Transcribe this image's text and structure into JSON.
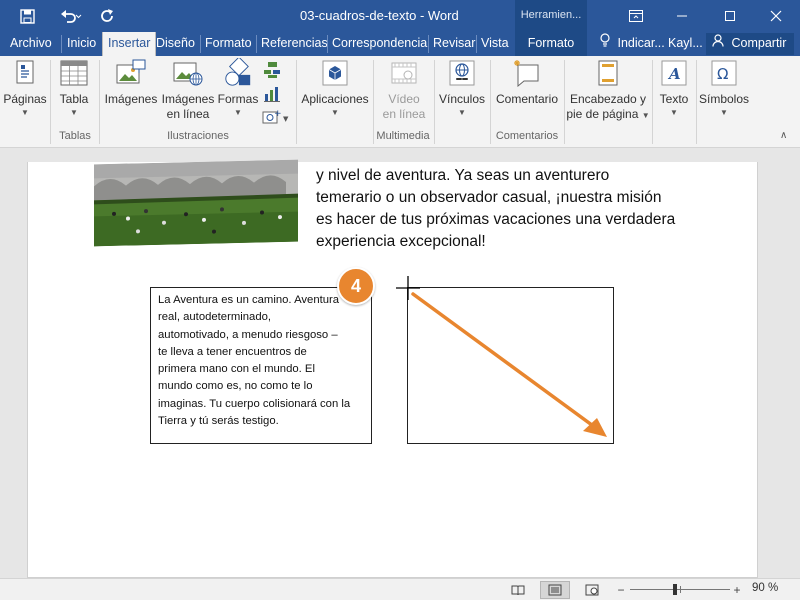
{
  "window": {
    "title": "03-cuadros-de-texto  -  Word",
    "contextual_group": "Herramien...",
    "colors": {
      "titlebar": "#2b579a",
      "contextual": "#1e4a86",
      "accent": "#e8862f"
    }
  },
  "quick_access": {
    "save_icon": "save-icon",
    "undo_icon": "undo-icon",
    "redo_icon": "redo-icon"
  },
  "tabs": [
    "Archivo",
    "Inicio",
    "Insertar",
    "Diseño",
    "Formato",
    "Referencias",
    "Correspondencia",
    "Revisar",
    "Vista",
    "Formato"
  ],
  "active_tab": "Insertar",
  "tell_me": "Indicar...",
  "user": "Kayl...",
  "share": "Compartir",
  "ribbon": {
    "paginas": "Páginas",
    "tabla": "Tabla",
    "imagenes": "Imágenes",
    "imagenes_linea_1": "Imágenes",
    "imagenes_linea_2": "en línea",
    "formas": "Formas",
    "aplicaciones": "Aplicaciones",
    "video_1": "Vídeo",
    "video_2": "en línea",
    "vinculos": "Vínculos",
    "comentario": "Comentario",
    "encabezado_1": "Encabezado y",
    "encabezado_2": "pie de página",
    "texto": "Texto",
    "simbolos": "Símbolos",
    "groups": {
      "tablas": "Tablas",
      "ilustraciones": "Ilustraciones",
      "multimedia": "Multimedia",
      "comentarios": "Comentarios"
    }
  },
  "document": {
    "body_lines": [
      "y nivel de aventura. Ya seas un aventurero",
      "temerario o un observador casual, ¡nuestra misión",
      "es hacer de tus próximas vacaciones una verdadera",
      "experiencia excepcional!"
    ],
    "textbox_lines": [
      "La Aventura es un camino. Aventura",
      "real, autodeterminado,",
      "automotivado, a menudo riesgoso –",
      "te lleva a tener encuentros de",
      "primera mano con el mundo. El",
      "mundo como es, no como te lo",
      "imaginas. Tu cuerpo colisionará con la",
      "Tierra y tú serás testigo."
    ],
    "step_badge": "4"
  },
  "status": {
    "zoom": "90 %",
    "zoom_level": 0.9
  }
}
